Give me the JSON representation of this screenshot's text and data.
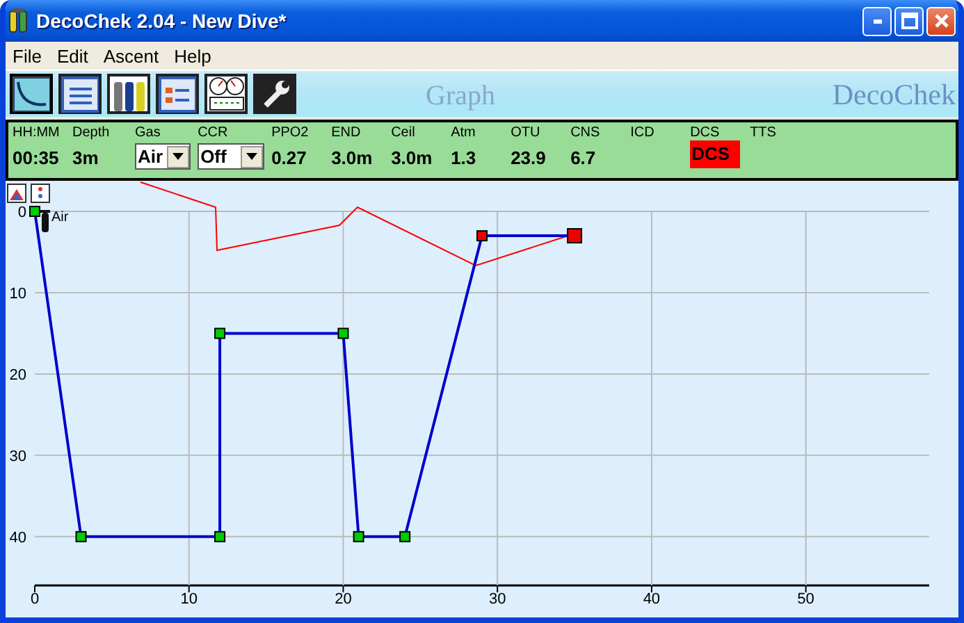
{
  "window": {
    "title": "DecoChek 2.04 - New Dive*"
  },
  "menu": [
    "File",
    "Edit",
    "Ascent",
    "Help"
  ],
  "toolbar": {
    "buttons": [
      {
        "kind": "graph",
        "selected": true
      },
      {
        "kind": "list",
        "selected": false
      },
      {
        "kind": "cylinders",
        "selected": false
      },
      {
        "kind": "form",
        "selected": false
      },
      {
        "kind": "gauges",
        "selected": false
      },
      {
        "kind": "wrench",
        "selected": false
      }
    ],
    "view_title": "Graph",
    "brand": "DecoChek"
  },
  "readout": [
    {
      "label": "HH:MM",
      "kind": "text",
      "value": "00:35"
    },
    {
      "label": "Depth",
      "kind": "text",
      "value": "3m"
    },
    {
      "label": "Gas",
      "kind": "select",
      "value": "Air"
    },
    {
      "label": "CCR",
      "kind": "select",
      "value": "Off"
    },
    {
      "label": "PPO2",
      "kind": "text",
      "value": "0.27"
    },
    {
      "label": "END",
      "kind": "text",
      "value": "3.0m"
    },
    {
      "label": "Ceil",
      "kind": "text",
      "value": "3.0m"
    },
    {
      "label": "Atm",
      "kind": "text",
      "value": "1.3"
    },
    {
      "label": "OTU",
      "kind": "text",
      "value": "23.9"
    },
    {
      "label": "CNS",
      "kind": "text",
      "value": "6.7"
    },
    {
      "label": "ICD",
      "kind": "empty"
    },
    {
      "label": "DCS",
      "kind": "alert",
      "value": "DCS"
    },
    {
      "label": "TTS",
      "kind": "empty"
    }
  ],
  "graph": {
    "chart_data": {
      "type": "line",
      "x": [
        0,
        3,
        12,
        12,
        20,
        21,
        24,
        29,
        35
      ],
      "series": [
        {
          "color": "#0000cc",
          "marker": "square",
          "values": [
            0,
            40,
            40,
            15,
            15,
            40,
            40,
            3,
            3
          ]
        }
      ],
      "grid": true,
      "xlim": [
        0,
        58
      ],
      "ylim": [
        46,
        0
      ],
      "xticks": [
        0,
        10,
        20,
        30,
        40,
        50
      ],
      "yticks": [
        0,
        10,
        20,
        30,
        40
      ],
      "annotations": [
        {
          "x": 0,
          "y": 0,
          "text": "Air"
        }
      ]
    },
    "point_markers": [
      {
        "color": "#00cc00"
      },
      {
        "color": "#00cc00"
      },
      {
        "color": "#00cc00"
      },
      {
        "color": "#00cc00"
      },
      {
        "color": "#00cc00"
      },
      {
        "color": "#00cc00"
      },
      {
        "color": "#00cc00"
      },
      {
        "color": "#ee0000"
      },
      {
        "color": "#ee0000"
      }
    ]
  }
}
